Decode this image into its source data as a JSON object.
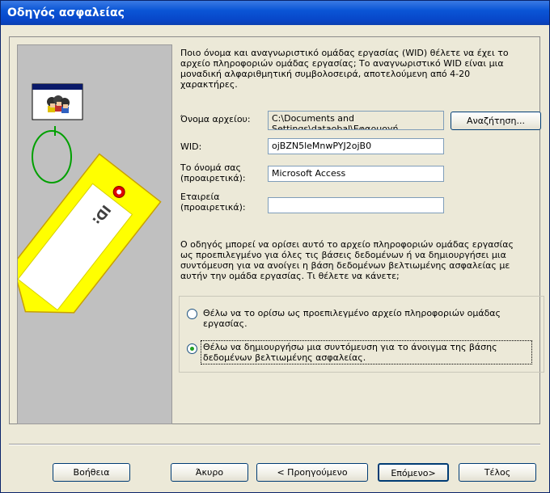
{
  "window": {
    "title": "Οδηγός ασφαλείας"
  },
  "intro": "Ποιο όνομα και αναγνωριστικό ομάδας εργασίας (WID) θέλετε να έχει το αρχείο πληροφοριών ομάδας εργασίας; Το αναγνωριστικό WID είναι μια μοναδική αλφαριθμητική συμβολοσειρά, αποτελούμενη από 4-20 χαρακτήρες.",
  "fields": {
    "filename_label": "Όνομα αρχείου:",
    "filename_value": "C:\\Documents and Settings\\dataobal\\Εφαρμογή",
    "browse_button": "Αναζήτηση...",
    "wid_label": "WID:",
    "wid_value": "ojBZN5leMnwPYJ2ojB0",
    "name_label": "Το όνομά σας (προαιρετικά):",
    "name_value": "Microsoft Access",
    "company_label": "Εταιρεία (προαιρετικά):",
    "company_value": ""
  },
  "info": "Ο οδηγός μπορεί να ορίσει αυτό το αρχείο πληροφοριών ομάδας εργασίας ως προεπιλεγμένο για όλες τις βάσεις δεδομένων ή να δημιουργήσει μια συντόμευση για να ανοίγει η βάση δεδομένων βελτιωμένης ασφαλείας με αυτήν την ομάδα εργασίας. Τι θέλετε να κάνετε;",
  "options": [
    {
      "label": "Θέλω να το ορίσω ως προεπιλεγμένο αρχείο πληροφοριών ομάδας εργασίας.",
      "selected": false
    },
    {
      "label": "Θέλω να δημιουργήσω μια συντόμευση για το άνοιγμα της βάσης δεδομένων βελτιωμένης ασφαλείας.",
      "selected": true
    }
  ],
  "buttons": {
    "help": "Βοήθεια",
    "cancel": "Άκυρο",
    "back": "< Προηγούμενο",
    "next": "Επόμενο>",
    "finish": "Τέλος"
  },
  "illustration": {
    "tag_text": "ID:"
  },
  "colors": {
    "title_bar": "#0A55D6",
    "tag": "#FFFF00",
    "panel": "#C0C0C0"
  }
}
